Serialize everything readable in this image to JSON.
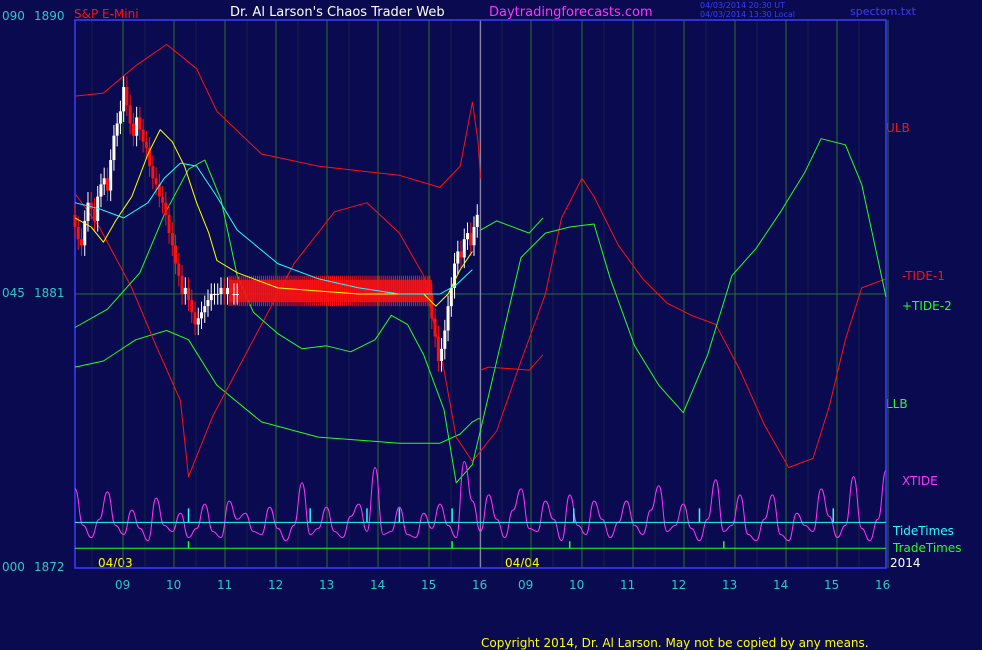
{
  "header": {
    "symbol": "S&P E-Mini",
    "title": "Dr. Al Larson's Chaos Trader Web",
    "site": "Daytradingforecasts.com",
    "time_ut": "04/03/2014 20:30 UT",
    "time_local": "04/03/2014 13:30 Local",
    "file": "spectom.txt"
  },
  "footer": {
    "copyright": "Copyright 2014, Dr. Al Larson. May not be copied by any means."
  },
  "colors": {
    "background": "#0a0a50",
    "frame": "#3c3cff",
    "grid_vertical": "#2a6e2a",
    "text_blue_green": "#2cc8c8",
    "red": "#ff1010",
    "green": "#22ff22",
    "magenta": "#ff33ff",
    "cyan": "#22ffff",
    "yellow": "#ffff00",
    "white": "#ffffff"
  },
  "chart_data": {
    "type": "line",
    "y_axis": {
      "pct_labels": [
        "090",
        "045",
        "000"
      ],
      "price_labels": [
        "1890",
        "1881",
        "1872"
      ],
      "ylim": [
        1872,
        1890
      ]
    },
    "x_axis": {
      "hour_ticks": [
        "09",
        "10",
        "11",
        "12",
        "13",
        "14",
        "15",
        "16",
        "09",
        "10",
        "11",
        "12",
        "13",
        "14",
        "15",
        "16"
      ],
      "date_labels": [
        "04/03",
        "04/04"
      ],
      "year_label": "2014"
    },
    "series_labels": [
      "ULB",
      "-TIDE-1",
      "+TIDE-2",
      "LLB",
      "XTIDE",
      "TideTimes",
      "TradeTimes"
    ],
    "curve_series": [
      {
        "name": "ULB",
        "color": "red",
        "width": 1,
        "x": [
          0,
          0.035,
          0.075,
          0.113,
          0.15,
          0.175,
          0.23,
          0.3,
          0.4,
          0.45,
          0.475,
          0.49,
          0.497,
          0.5
        ],
        "y": [
          1887.5,
          1887.6,
          1888.5,
          1889.2,
          1888.4,
          1887.0,
          1885.6,
          1885.2,
          1884.9,
          1884.5,
          1885.2,
          1887.3,
          1886.0,
          1884.8
        ]
      },
      {
        "name": "LLB",
        "color": "green",
        "width": 1,
        "x": [
          0,
          0.035,
          0.075,
          0.113,
          0.14,
          0.175,
          0.23,
          0.3,
          0.4,
          0.45,
          0.475,
          0.49,
          0.497,
          0.5
        ],
        "y": [
          1878.6,
          1878.8,
          1879.5,
          1879.8,
          1879.5,
          1878.0,
          1876.8,
          1876.3,
          1876.1,
          1876.1,
          1876.4,
          1876.8,
          1876.9,
          1876.9
        ]
      },
      {
        "name": "ULB-2",
        "color": "red",
        "width": 1,
        "x": [
          0.5,
          0.51,
          0.56,
          0.577
        ],
        "y": [
          1878.5,
          1878.6,
          1878.5,
          1879.0
        ]
      },
      {
        "name": "LLB-2",
        "color": "green",
        "width": 1,
        "x": [
          0.5,
          0.52,
          0.56,
          0.577
        ],
        "y": [
          1883.1,
          1883.4,
          1883.0,
          1883.5
        ]
      },
      {
        "name": "-TIDE-1",
        "color": "red",
        "width": 1,
        "x": [
          0,
          0.03,
          0.07,
          0.1,
          0.13,
          0.14,
          0.17,
          0.22,
          0.27,
          0.32,
          0.36,
          0.4,
          0.43,
          0.455,
          0.47,
          0.49,
          0.52,
          0.55,
          0.58,
          0.6,
          0.625,
          0.64,
          0.67,
          0.7,
          0.73,
          0.76,
          0.79,
          0.82,
          0.85,
          0.88,
          0.91,
          0.93,
          0.95,
          0.97,
          1.0
        ],
        "y": [
          1884.3,
          1883.2,
          1881.2,
          1879.3,
          1877.5,
          1875.0,
          1877.0,
          1879.5,
          1882.0,
          1883.7,
          1884.0,
          1883.0,
          1881.6,
          1878.5,
          1876.3,
          1875.5,
          1876.5,
          1878.8,
          1881.0,
          1883.5,
          1884.8,
          1884.2,
          1882.6,
          1881.5,
          1880.7,
          1880.3,
          1880.0,
          1878.5,
          1876.7,
          1875.3,
          1875.6,
          1877.3,
          1879.5,
          1881.2,
          1881.5
        ]
      },
      {
        "name": "+TIDE-2",
        "color": "green",
        "width": 1,
        "x": [
          0,
          0.04,
          0.08,
          0.11,
          0.14,
          0.16,
          0.18,
          0.2,
          0.22,
          0.25,
          0.28,
          0.31,
          0.34,
          0.37,
          0.39,
          0.41,
          0.43,
          0.455,
          0.47,
          0.49,
          0.52,
          0.55,
          0.58,
          0.61,
          0.64,
          0.66,
          0.69,
          0.72,
          0.75,
          0.78,
          0.81,
          0.84,
          0.87,
          0.9,
          0.92,
          0.95,
          0.97,
          1.0
        ],
        "y": [
          1879.9,
          1880.5,
          1881.7,
          1883.6,
          1885.1,
          1885.4,
          1884.1,
          1881.6,
          1880.4,
          1879.7,
          1879.2,
          1879.3,
          1879.1,
          1879.5,
          1880.3,
          1880.0,
          1879.0,
          1877.2,
          1874.8,
          1875.4,
          1878.8,
          1882.2,
          1883.0,
          1883.2,
          1883.3,
          1881.5,
          1879.3,
          1878.0,
          1877.1,
          1879.0,
          1881.6,
          1882.5,
          1883.7,
          1885.0,
          1886.1,
          1885.9,
          1884.6,
          1880.9
        ]
      },
      {
        "name": "fast-avg",
        "color": "yellow",
        "width": 1,
        "x": [
          0,
          0.02,
          0.035,
          0.05,
          0.07,
          0.09,
          0.105,
          0.12,
          0.135,
          0.15,
          0.165,
          0.175,
          0.2,
          0.25,
          0.3,
          0.35,
          0.4,
          0.43,
          0.445,
          0.46,
          0.475,
          0.49
        ],
        "y": [
          1883.5,
          1883.2,
          1882.7,
          1883.4,
          1884.2,
          1885.6,
          1886.4,
          1886.0,
          1885.2,
          1884.0,
          1883.0,
          1882.1,
          1881.7,
          1881.2,
          1881.1,
          1881.0,
          1881.0,
          1881.0,
          1880.6,
          1881.0,
          1881.8,
          1882.4
        ]
      },
      {
        "name": "slow-avg",
        "color": "cyan",
        "width": 1,
        "x": [
          0,
          0.03,
          0.06,
          0.09,
          0.11,
          0.13,
          0.15,
          0.175,
          0.2,
          0.25,
          0.3,
          0.35,
          0.4,
          0.43,
          0.45,
          0.47,
          0.49
        ],
        "y": [
          1884.0,
          1883.8,
          1883.5,
          1884.0,
          1884.8,
          1885.3,
          1885.2,
          1884.2,
          1883.1,
          1882.0,
          1881.5,
          1881.2,
          1881.0,
          1881.0,
          1881.0,
          1881.3,
          1881.8
        ]
      }
    ],
    "price_bars": {
      "x": [
        0,
        0.004,
        0.008,
        0.012,
        0.016,
        0.02,
        0.024,
        0.028,
        0.032,
        0.036,
        0.04,
        0.044,
        0.048,
        0.052,
        0.056,
        0.06,
        0.064,
        0.068,
        0.072,
        0.076,
        0.08,
        0.084,
        0.088,
        0.092,
        0.096,
        0.1,
        0.104,
        0.108,
        0.112,
        0.116,
        0.12,
        0.124,
        0.128,
        0.132,
        0.136,
        0.14,
        0.144,
        0.148,
        0.152,
        0.156,
        0.16,
        0.164,
        0.168,
        0.172,
        0.176,
        0.18,
        0.184,
        0.188,
        0.192,
        0.196,
        0.2,
        0.44,
        0.444,
        0.448,
        0.452,
        0.456,
        0.46,
        0.464,
        0.468,
        0.472,
        0.476,
        0.48,
        0.484,
        0.488,
        0.492,
        0.496
      ],
      "open": [
        1883.6,
        1883.2,
        1882.8,
        1882.6,
        1883.4,
        1884.0,
        1883.8,
        1883.4,
        1884.2,
        1884.6,
        1884.8,
        1884.4,
        1885.4,
        1886.2,
        1886.6,
        1887.0,
        1887.8,
        1887.2,
        1886.6,
        1886.2,
        1886.8,
        1886.4,
        1886.0,
        1885.8,
        1885.2,
        1884.8,
        1884.6,
        1884.2,
        1884.0,
        1883.6,
        1883.0,
        1882.6,
        1882.0,
        1881.6,
        1881.0,
        1881.2,
        1880.8,
        1880.4,
        1880.0,
        1880.2,
        1880.4,
        1880.6,
        1880.8,
        1881.0,
        1881.0,
        1881.0,
        1881.2,
        1881.0,
        1881.2,
        1881.0,
        1881.0,
        1881.0,
        1880.2,
        1879.6,
        1878.8,
        1879.2,
        1879.8,
        1880.6,
        1881.2,
        1882.0,
        1882.4,
        1882.2,
        1882.8,
        1883.0,
        1882.6,
        1883.2
      ],
      "close": [
        1883.2,
        1882.8,
        1882.6,
        1883.4,
        1884.0,
        1883.8,
        1883.4,
        1884.2,
        1884.6,
        1884.8,
        1884.4,
        1885.4,
        1886.2,
        1886.6,
        1887.0,
        1887.8,
        1887.2,
        1886.6,
        1886.2,
        1886.8,
        1886.4,
        1886.0,
        1885.8,
        1885.2,
        1884.8,
        1884.6,
        1884.2,
        1884.0,
        1883.6,
        1883.0,
        1882.6,
        1882.0,
        1881.6,
        1881.0,
        1881.2,
        1880.8,
        1880.4,
        1880.0,
        1880.2,
        1880.4,
        1880.6,
        1880.8,
        1881.0,
        1881.0,
        1881.0,
        1881.2,
        1881.0,
        1881.2,
        1881.0,
        1881.0,
        1881.0,
        1880.2,
        1879.6,
        1878.8,
        1879.2,
        1879.8,
        1880.6,
        1881.2,
        1882.0,
        1882.4,
        1882.2,
        1882.8,
        1883.0,
        1882.6,
        1883.2,
        1883.6
      ],
      "flat_band": {
        "x": [
          0.19,
          0.44
        ],
        "low": 1880.6,
        "high": 1881.6
      }
    },
    "xtide": {
      "name": "XTIDE",
      "color": "magenta",
      "x": [
        0,
        0.01,
        0.02,
        0.03,
        0.04,
        0.05,
        0.06,
        0.07,
        0.08,
        0.09,
        0.1,
        0.11,
        0.12,
        0.13,
        0.14,
        0.15,
        0.16,
        0.17,
        0.18,
        0.19,
        0.2,
        0.21,
        0.22,
        0.23,
        0.24,
        0.25,
        0.26,
        0.27,
        0.28,
        0.29,
        0.3,
        0.31,
        0.32,
        0.33,
        0.34,
        0.35,
        0.36,
        0.37,
        0.38,
        0.39,
        0.4,
        0.41,
        0.42,
        0.43,
        0.44,
        0.45,
        0.46,
        0.47,
        0.48,
        0.49,
        0.5,
        0.51,
        0.52,
        0.53,
        0.54,
        0.55,
        0.56,
        0.57,
        0.58,
        0.59,
        0.6,
        0.61,
        0.62,
        0.63,
        0.64,
        0.65,
        0.66,
        0.67,
        0.68,
        0.69,
        0.7,
        0.71,
        0.72,
        0.73,
        0.74,
        0.75,
        0.76,
        0.77,
        0.78,
        0.79,
        0.8,
        0.81,
        0.82,
        0.83,
        0.84,
        0.85,
        0.86,
        0.87,
        0.88,
        0.89,
        0.9,
        0.91,
        0.92,
        0.93,
        0.94,
        0.95,
        0.96,
        0.97,
        0.98,
        0.99,
        1.0
      ],
      "y": [
        1874.6,
        1873.4,
        1873.0,
        1873.6,
        1874.5,
        1873.4,
        1873.1,
        1873.9,
        1873.3,
        1872.9,
        1874.3,
        1873.4,
        1873.2,
        1873.8,
        1873.0,
        1873.3,
        1874.1,
        1873.2,
        1873.0,
        1874.2,
        1873.6,
        1873.8,
        1873.2,
        1873.1,
        1874.0,
        1873.3,
        1872.9,
        1873.4,
        1874.8,
        1873.1,
        1873.3,
        1874.0,
        1873.2,
        1873.0,
        1873.7,
        1874.1,
        1873.2,
        1875.3,
        1873.1,
        1873.2,
        1874.0,
        1873.1,
        1873.0,
        1873.8,
        1873.3,
        1874.1,
        1873.4,
        1873.0,
        1875.5,
        1874.2,
        1873.2,
        1874.4,
        1873.6,
        1873.0,
        1873.9,
        1874.6,
        1873.3,
        1873.2,
        1874.2,
        1873.6,
        1872.9,
        1874.4,
        1873.4,
        1873.1,
        1874.2,
        1873.6,
        1873.0,
        1873.5,
        1874.2,
        1873.4,
        1873.1,
        1873.9,
        1874.7,
        1873.2,
        1873.4,
        1874.1,
        1873.3,
        1872.9,
        1873.6,
        1874.9,
        1873.2,
        1873.4,
        1874.4,
        1873.1,
        1872.9,
        1873.6,
        1874.4,
        1873.1,
        1872.9,
        1873.8,
        1873.4,
        1873.2,
        1874.6,
        1873.7,
        1873.0,
        1873.4,
        1875.0,
        1873.3,
        1872.9,
        1873.6,
        1875.2
      ]
    },
    "tide_times": {
      "y": 1873.5,
      "ticks_x": [
        0.14,
        0.29,
        0.36,
        0.4,
        0.465,
        0.615,
        0.77,
        0.935
      ],
      "color": "cyan"
    },
    "trade_times": {
      "y": 1872.65,
      "ticks_x": [
        0.14,
        0.465,
        0.61,
        0.8
      ],
      "color": "green"
    }
  }
}
